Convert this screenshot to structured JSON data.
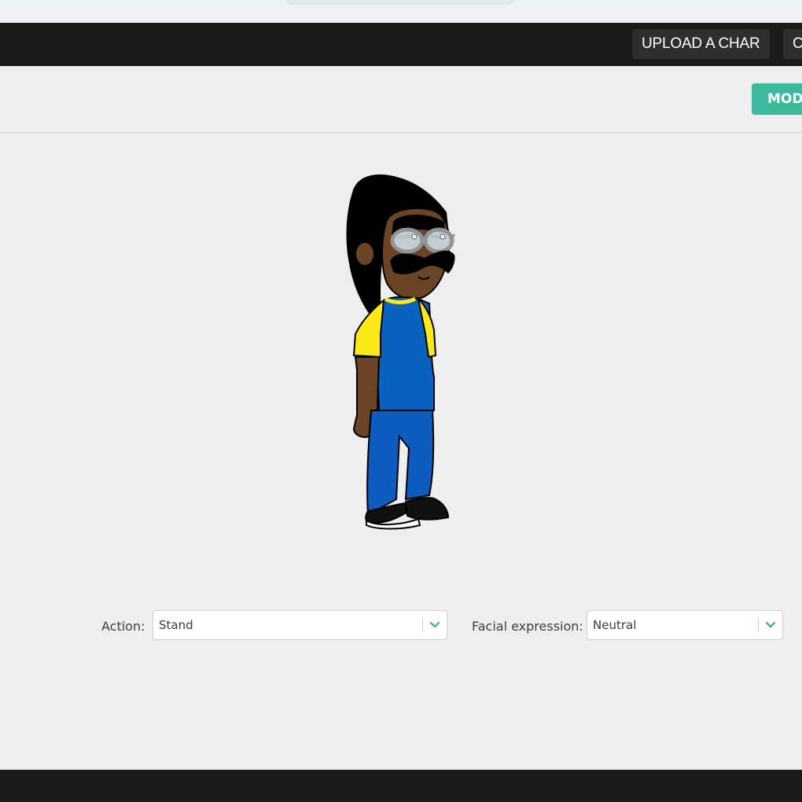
{
  "header": {
    "upload_button_label": "UPLOAD A CHAR",
    "clipped_button_label": "C"
  },
  "toolbar": {
    "modify_button_label": "MODI"
  },
  "character": {
    "hair_color": "#000000",
    "skin_color": "#6b4426",
    "shirt_color": "#0a62bf",
    "sleeve_color": "#fbe91a",
    "pants_color": "#0d5cc0",
    "shoes_color": "#111111",
    "glasses_color": "#8c9598"
  },
  "controls": {
    "action": {
      "label": "Action:",
      "value": "Stand"
    },
    "facial_expression": {
      "label": "Facial expression:",
      "value": "Neutral"
    },
    "accent_color": "#3cb89c"
  }
}
